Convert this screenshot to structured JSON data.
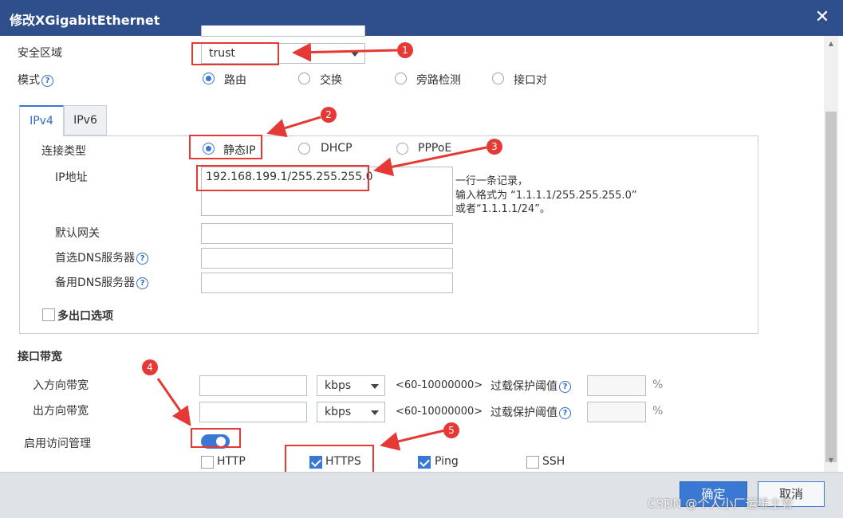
{
  "window": {
    "title": "修改XGigabitEthernet",
    "close_glyph": "✕"
  },
  "security_zone": {
    "label": "安全区域",
    "value": "trust"
  },
  "mode": {
    "label": "模式",
    "options": [
      "路由",
      "交换",
      "旁路检测",
      "接口对"
    ],
    "selected": 0
  },
  "tabs": [
    {
      "label": "IPv4",
      "active": true
    },
    {
      "label": "IPv6",
      "active": false
    }
  ],
  "connection_type": {
    "label": "连接类型",
    "options": [
      "静态IP",
      "DHCP",
      "PPPoE"
    ],
    "selected": 0
  },
  "ip_address": {
    "label": "IP地址",
    "value": "192.168.199.1/255.255.255.0",
    "hint_line1": "一行一条记录，",
    "hint_line2": "输入格式为 “1.1.1.1/255.255.255.0”",
    "hint_line3": "或者“1.1.1.1/24”。"
  },
  "gateway": {
    "label": "默认网关",
    "value": ""
  },
  "dns_primary": {
    "label": "首选DNS服务器",
    "value": ""
  },
  "dns_backup": {
    "label": "备用DNS服务器",
    "value": ""
  },
  "multi_exit": {
    "label": "多出口选项",
    "checked": false
  },
  "bandwidth": {
    "section_label": "接口带宽",
    "inbound": {
      "label": "入方向带宽",
      "value": "",
      "unit": "kbps",
      "range": "<60-10000000>",
      "overload_label": "过载保护阈值",
      "percent": "%"
    },
    "outbound": {
      "label": "出方向带宽",
      "value": "",
      "unit": "kbps",
      "range": "<60-10000000>",
      "overload_label": "过载保护阈值",
      "percent": "%"
    }
  },
  "access_mgmt": {
    "label": "启用访问管理",
    "enabled": true,
    "options": [
      {
        "label": "HTTP",
        "checked": false
      },
      {
        "label": "HTTPS",
        "checked": true
      },
      {
        "label": "Ping",
        "checked": true
      },
      {
        "label": "SSH",
        "checked": false
      }
    ]
  },
  "footer": {
    "ok_label": "确定",
    "cancel_label": "取消"
  },
  "annotations": [
    "1",
    "2",
    "3",
    "4",
    "5"
  ],
  "help_glyph": "?",
  "watermark": "CSDN @个人小厂运维主管",
  "colors": {
    "titlebar": "#2e4f8c",
    "accent": "#3a78d4",
    "annotation": "#e53935"
  }
}
